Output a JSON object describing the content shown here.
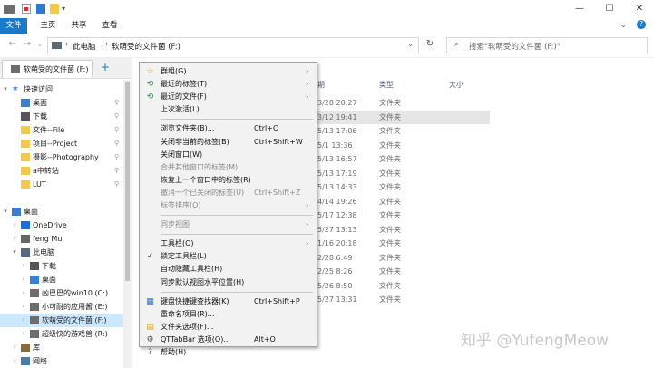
{
  "ribbon": {
    "tabs": [
      "文件",
      "主页",
      "共享",
      "查看"
    ]
  },
  "window_controls": {
    "minimize": "—",
    "maximize": "☐",
    "close": "✕"
  },
  "address": {
    "path": [
      "此电脑",
      "软萌受的文件菌 (F:)"
    ],
    "search_placeholder": "搜索\"软萌受的文件菌 (F:)\""
  },
  "qttabbar": {
    "tab_label": "软萌受的文件菌 (F:)",
    "add_label": "+"
  },
  "nav": {
    "items": [
      {
        "label": "快速访问",
        "level": 0,
        "chev": "▾",
        "icon": "star",
        "pinned": false
      },
      {
        "label": "桌面",
        "level": 1,
        "chev": "",
        "icon": "desktop",
        "pinned": true
      },
      {
        "label": "下载",
        "level": 1,
        "chev": "",
        "icon": "download",
        "pinned": true
      },
      {
        "label": "文件--File",
        "level": 1,
        "chev": "",
        "icon": "folder",
        "pinned": true
      },
      {
        "label": "项目--Project",
        "level": 1,
        "chev": "",
        "icon": "folder",
        "pinned": true
      },
      {
        "label": "摄影--Photography",
        "level": 1,
        "chev": "",
        "icon": "folder",
        "pinned": true
      },
      {
        "label": "a中转站",
        "level": 1,
        "chev": "",
        "icon": "folder",
        "pinned": true
      },
      {
        "label": "LUT",
        "level": 1,
        "chev": "",
        "icon": "folder",
        "pinned": true
      },
      {
        "label": "",
        "level": 0,
        "chev": "",
        "icon": "",
        "pinned": false
      },
      {
        "label": "桌面",
        "level": 0,
        "chev": "▾",
        "icon": "desktop",
        "pinned": false
      },
      {
        "label": "OneDrive",
        "level": 1,
        "chev": "›",
        "icon": "cloud",
        "pinned": false
      },
      {
        "label": "feng Mu",
        "level": 1,
        "chev": "›",
        "icon": "user",
        "pinned": false
      },
      {
        "label": "此电脑",
        "level": 1,
        "chev": "▾",
        "icon": "pc",
        "pinned": false
      },
      {
        "label": "下载",
        "level": 2,
        "chev": "›",
        "icon": "download",
        "pinned": false
      },
      {
        "label": "桌面",
        "level": 2,
        "chev": "›",
        "icon": "desktop",
        "pinned": false
      },
      {
        "label": "凶巴巴的win10 (C:)",
        "level": 2,
        "chev": "›",
        "icon": "drive",
        "pinned": false
      },
      {
        "label": "小可耐的应用酱 (E:)",
        "level": 2,
        "chev": "›",
        "icon": "drive",
        "pinned": false
      },
      {
        "label": "软萌受的文件菌 (F:)",
        "level": 2,
        "chev": "›",
        "icon": "drive",
        "pinned": false,
        "selected": true
      },
      {
        "label": "超级快的游戏兽 (R:)",
        "level": 2,
        "chev": "›",
        "icon": "drive",
        "pinned": false
      },
      {
        "label": "库",
        "level": 1,
        "chev": "›",
        "icon": "lib",
        "pinned": false
      },
      {
        "label": "网络",
        "level": 1,
        "chev": "›",
        "icon": "net",
        "pinned": false
      }
    ]
  },
  "columns": {
    "date_partial": "期",
    "type": "类型",
    "size": "大小"
  },
  "files": [
    {
      "date": "3/28 20:27",
      "type": "文件夹"
    },
    {
      "date": "3/12 19:41",
      "type": "文件夹"
    },
    {
      "date": "5/13 17:06",
      "type": "文件夹"
    },
    {
      "date": "5/1 13:36",
      "type": "文件夹"
    },
    {
      "date": "5/13 16:57",
      "type": "文件夹"
    },
    {
      "date": "5/13 17:19",
      "type": "文件夹"
    },
    {
      "date": "5/13 14:33",
      "type": "文件夹"
    },
    {
      "date": "4/14 19:26",
      "type": "文件夹"
    },
    {
      "date": "5/17 12:38",
      "type": "文件夹"
    },
    {
      "date": "5/27 13:13",
      "type": "文件夹"
    },
    {
      "date": "1/16 20:18",
      "type": "文件夹"
    },
    {
      "date": "2/28 6:49",
      "type": "文件夹"
    },
    {
      "date": "2/25 8:26",
      "type": "文件夹"
    },
    {
      "date": "5/26 8:50",
      "type": "文件夹"
    },
    {
      "date": "5/27 13:31",
      "type": "文件夹"
    }
  ],
  "menu": {
    "items": [
      {
        "label": "群组(G)",
        "shortcut": "",
        "arrow": "›",
        "icon": "☆",
        "disabled": false
      },
      {
        "label": "最近的标签(T)",
        "shortcut": "",
        "arrow": "›",
        "icon": "⟲",
        "disabled": false
      },
      {
        "label": "最近的文件(F)",
        "shortcut": "",
        "arrow": "›",
        "icon": "⟲",
        "disabled": false
      },
      {
        "label": "上次激活(L)",
        "shortcut": "",
        "arrow": "",
        "icon": "",
        "disabled": false
      },
      {
        "sep": true
      },
      {
        "label": "浏览文件夹(B)...",
        "shortcut": "Ctrl+O",
        "arrow": "",
        "icon": "",
        "disabled": false
      },
      {
        "label": "关闭非当前的标签(B)",
        "shortcut": "Ctrl+Shift+W",
        "arrow": "",
        "icon": "",
        "disabled": false
      },
      {
        "label": "关闭窗口(W)",
        "shortcut": "",
        "arrow": "",
        "icon": "",
        "disabled": false
      },
      {
        "label": "合并其他窗口的标签(M)",
        "shortcut": "",
        "arrow": "",
        "icon": "",
        "disabled": true
      },
      {
        "label": "恢复上一个窗口中的标签(R)",
        "shortcut": "",
        "arrow": "",
        "icon": "",
        "disabled": false
      },
      {
        "label": "撤消一个已关闭的标签(U)",
        "shortcut": "Ctrl+Shift+Z",
        "arrow": "",
        "icon": "",
        "disabled": true
      },
      {
        "label": "标签排序(O)",
        "shortcut": "",
        "arrow": "›",
        "icon": "",
        "disabled": true
      },
      {
        "sep": true
      },
      {
        "label": "同步视图",
        "shortcut": "",
        "arrow": "›",
        "icon": "",
        "disabled": true
      },
      {
        "sep": true
      },
      {
        "label": "工具栏(O)",
        "shortcut": "",
        "arrow": "›",
        "icon": "",
        "disabled": false
      },
      {
        "label": "锁定工具栏(L)",
        "shortcut": "",
        "arrow": "",
        "icon": "✓",
        "disabled": false
      },
      {
        "label": "自动隐藏工具栏(H)",
        "shortcut": "",
        "arrow": "",
        "icon": "",
        "disabled": false
      },
      {
        "label": "同步默认视图水平位置(H)",
        "shortcut": "",
        "arrow": "",
        "icon": "",
        "disabled": false
      },
      {
        "sep": true
      },
      {
        "label": "键盘快捷键查找器(K)",
        "shortcut": "Ctrl+Shift+P",
        "arrow": "",
        "icon": "▦",
        "disabled": false
      },
      {
        "label": "重命名项目(R)...",
        "shortcut": "",
        "arrow": "",
        "icon": "",
        "disabled": false
      },
      {
        "label": "文件夹选项(F)...",
        "shortcut": "",
        "arrow": "",
        "icon": "▤",
        "disabled": false
      },
      {
        "label": "QTTabBar 选项(O)...",
        "shortcut": "Alt+O",
        "arrow": "",
        "icon": "⚙",
        "disabled": false
      },
      {
        "label": "帮助(H)",
        "shortcut": "",
        "arrow": "",
        "icon": "?",
        "disabled": false
      }
    ]
  },
  "watermark": "知乎 @YufengMeow",
  "colors": {
    "accent": "#1979ca",
    "folder": "#f4c84a",
    "selection": "#cce8ff"
  }
}
